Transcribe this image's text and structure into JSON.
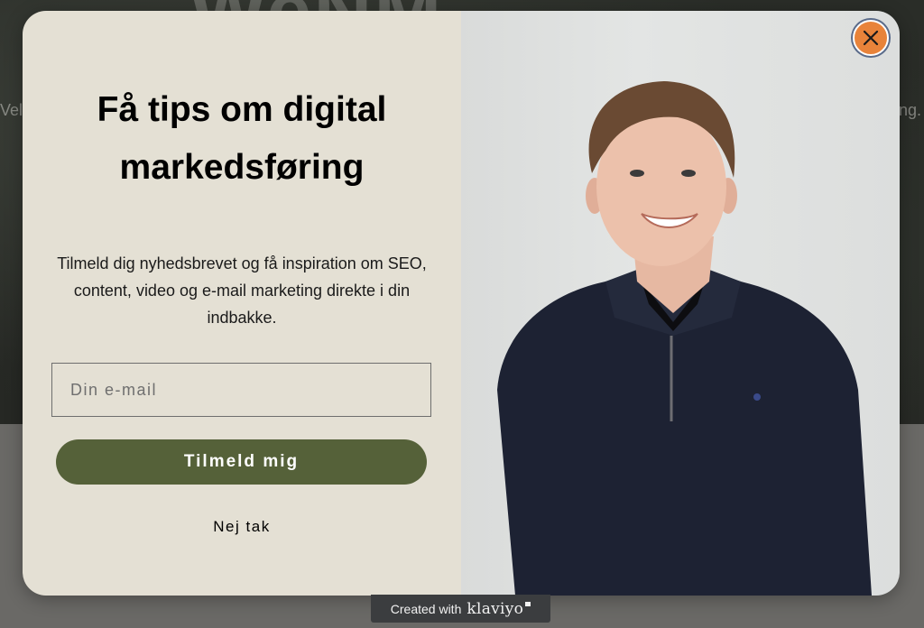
{
  "background": {
    "heading": "WeNM",
    "text_left": "Vel",
    "text_right": "ng."
  },
  "popup": {
    "headline": "Få tips om digital markedsføring",
    "description": "Tilmeld dig nyhedsbrevet og få inspiration om SEO, content, video og e-mail marketing direkte i din indbakke.",
    "email_placeholder": "Din e-mail",
    "email_value": "",
    "submit_label": "Tilmeld mig",
    "decline_label": "Nej tak",
    "close_icon": "close-icon",
    "photo": "man-in-navy-quarter-zip-sweater"
  },
  "footer": {
    "created_with": "Created with",
    "brand": "klaviyo"
  },
  "colors": {
    "panel_bg": "#e4e0d4",
    "button_bg": "#556139",
    "close_bg": "#e8833a",
    "badge_bg": "#3b3d3f"
  }
}
